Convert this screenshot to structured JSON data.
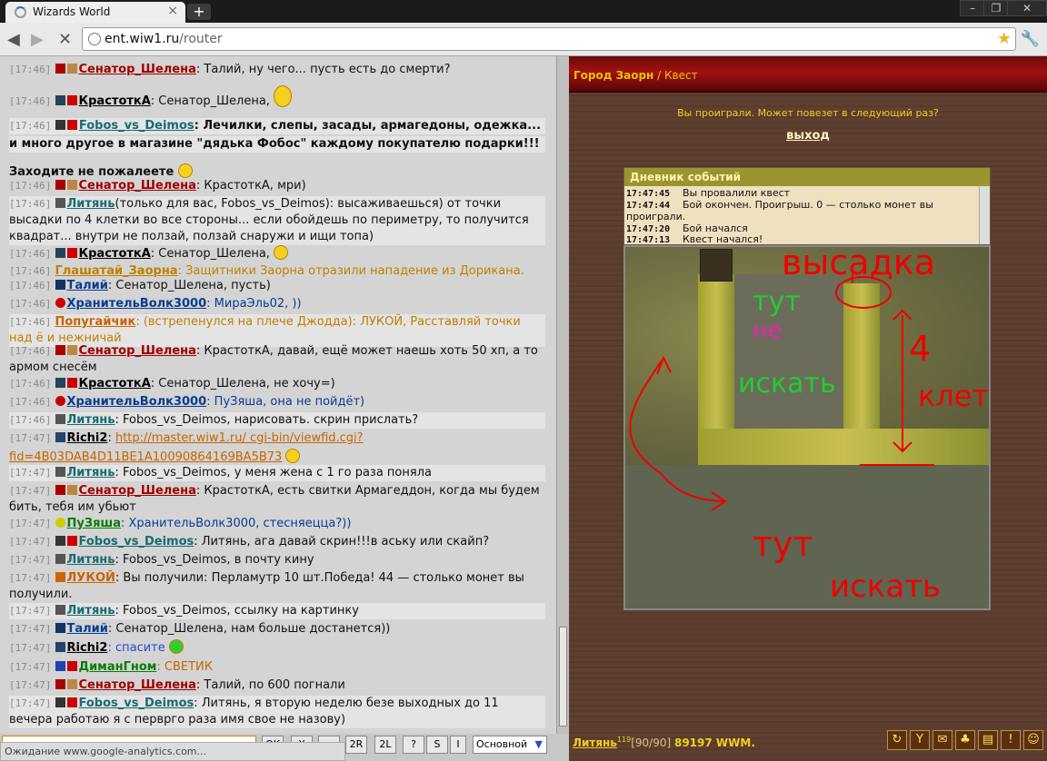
{
  "browser": {
    "tab_title": "Wizards World",
    "tab_close": "×",
    "new_tab": "+",
    "url_host": "ent.wiw1.ru",
    "url_path": "/router",
    "status": "Ожидание www.google-analytics.com..."
  },
  "chat": [
    {
      "time": "[17:46]",
      "nick": "Сенатор_Шелена",
      "nick_color": "#a00000",
      "text": ": Талий, ну чего... пусть есть до смерти?"
    },
    {
      "time": "[17:46]",
      "nick": "КрастоткА",
      "nick_color": "#000000",
      "text": ": Сенатор_Шелена,"
    },
    {
      "time": "[17:46]",
      "nick": "Fobos_vs_Deimos",
      "nick_color": "#1a6b70",
      "text": ": Лечилки, слепы, засады, армагедоны, одежка..."
    },
    {
      "time": "",
      "nick": "",
      "nick_color": "#000000",
      "text": "и много другое в магазине \"дядька Фобос\" каждому покупателю подарки!!!"
    },
    {
      "time": "",
      "nick": "",
      "nick_color": "#000000",
      "text": "Заходите не пожалеете"
    },
    {
      "time": "[17:46]",
      "nick": "Сенатор_Шелена",
      "nick_color": "#a00000",
      "text": ": КрастоткА, мри)"
    },
    {
      "time": "[17:46]",
      "nick": "Литянь",
      "nick_color": "#1a6b70",
      "text": "(только для вас, Fobos_vs_Deimos): высаживаешься) от точки высадки по 4 клетки во все стороны... если обойдешь по периметру, то получится квадрат... внутри не ползай, ползай снаружи и ищи топа)"
    },
    {
      "time": "[17:46]",
      "nick": "КрастоткА",
      "nick_color": "#000000",
      "text": ": Сенатор_Шелена,"
    },
    {
      "time": "[17:46]",
      "nick": "Глашатай_Заорна",
      "nick_color": "#c08000",
      "text": ": Защитники Заорна отразили нападение из Дорикана."
    },
    {
      "time": "[17:46]",
      "nick": "Талий",
      "nick_color": "#0a3c90",
      "text": ": Сенатор_Шелена, пусть)"
    },
    {
      "time": "[17:46]",
      "nick": "ХранительВолк3000",
      "nick_color": "#0a3c90",
      "text": ": МираЭль02, ))"
    },
    {
      "time": "[17:46]",
      "nick": "Попугайчик",
      "nick_color": "#c86400",
      "text": ": (встрепенулся на плече Джодда): ЛУКОЙ, Расставляй точки над ё и нежничай"
    },
    {
      "time": "[17:46]",
      "nick": "Сенатор_Шелена",
      "nick_color": "#a00000",
      "text": ": КрастоткА, давай, ещё может наешь хоть 50 хп, а то армом снесём"
    },
    {
      "time": "[17:46]",
      "nick": "КрастоткА",
      "nick_color": "#000000",
      "text": ": Сенатор_Шелена, не хочу=)"
    },
    {
      "time": "[17:46]",
      "nick": "ХранительВолк3000",
      "nick_color": "#0a3c90",
      "text": ": ПуЗяша, она не пойдёт)"
    },
    {
      "time": "[17:46]",
      "nick": "Литянь",
      "nick_color": "#1a6b70",
      "text": ": Fobos_vs_Deimos, нарисовать. скрин прислать?"
    },
    {
      "time": "[17:47]",
      "nick": "Richi2",
      "nick_color": "#000000",
      "text": ":"
    },
    {
      "time": "",
      "nick": "",
      "nick_color": "#000000",
      "text": ""
    },
    {
      "time": "[17:47]",
      "nick": "Литянь",
      "nick_color": "#1a6b70",
      "text": ": Fobos_vs_Deimos, у меня жена с 1 го раза поняла"
    },
    {
      "time": "[17:47]",
      "nick": "Сенатор_Шелена",
      "nick_color": "#a00000",
      "text": ": КрастоткА, есть свитки Армагеддон, когда мы будем бить, тебя им убьют"
    },
    {
      "time": "[17:47]",
      "nick": "ПуЗяша",
      "nick_color": "#0a7a0a",
      "text": ": ХранительВолк3000, стесняецца?))"
    },
    {
      "time": "[17:47]",
      "nick": "Fobos_vs_Deimos",
      "nick_color": "#1a6b70",
      "text": ": Литянь, ага давай скрин!!!в аську или скайп?"
    },
    {
      "time": "[17:47]",
      "nick": "Литянь",
      "nick_color": "#1a6b70",
      "text": ": Fobos_vs_Deimos, в почту кину"
    },
    {
      "time": "[17:47]",
      "nick": "ЛУКОЙ",
      "nick_color": "#c86400",
      "text": ": Вы получили: Перламутр 10 шт.Победа! 44 — столько монет вы получили."
    },
    {
      "time": "[17:47]",
      "nick": "Литянь",
      "nick_color": "#1a6b70",
      "text": ": Fobos_vs_Deimos, ссылку на картинку"
    },
    {
      "time": "[17:47]",
      "nick": "Талий",
      "nick_color": "#0a3c90",
      "text": ": Сенатор_Шелена, нам больше достанется))"
    },
    {
      "time": "[17:47]",
      "nick": "Richi2",
      "nick_color": "#000000",
      "text": ": спасите"
    },
    {
      "time": "[17:47]",
      "nick": "ДиманГном",
      "nick_color": "#0a7a0a",
      "text": ": СВЕТИК"
    },
    {
      "time": "[17:47]",
      "nick": "Сенатор_Шелена",
      "nick_color": "#a00000",
      "text": ": Талий, по 600 погнали"
    },
    {
      "time": "[17:47]",
      "nick": "Fobos_vs_Deimos",
      "nick_color": "#1a6b70",
      "text": ": Литянь, я вторую неделю безе выходных до 11 вечера работаю я с перврго раза имя свое не назову)"
    }
  ],
  "richi_link": "http://master.wiw1.ru/ cgi-bin/viewfid.cgi?",
  "richi_link2": "fid=4B03DAB4D11BE1A10090864169BA5B73",
  "input_buttons": [
    "OK",
    "X",
    "→",
    "2R",
    "2L",
    "?",
    "S",
    "I"
  ],
  "channel": "Основной",
  "game": {
    "breadcrumb_city": "Город Заорн",
    "breadcrumb_sep": " / ",
    "breadcrumb_page": "Квест",
    "lost_message": "Вы проиграли. Может повезет в следующий раз?",
    "exit_label": "выход",
    "diary_title": "Дневник событий",
    "diary": [
      {
        "time": "17:47:45",
        "text": "Вы провалили квест"
      },
      {
        "time": "17:47:44",
        "text": "Бой окончен. Проигрыш. 0 — столько монет вы проиграли."
      },
      {
        "time": "17:47:20",
        "text": "Бой начался"
      },
      {
        "time": "17:47:13",
        "text": "Квест начался!"
      }
    ],
    "annotations": {
      "vysadka": "высадка",
      "tut_ne": "тут",
      "ne": "не",
      "iskat": "искать",
      "four": "4",
      "kletki": "клетки",
      "tut": "тут",
      "iskat2": "искать"
    },
    "player_name": "Литянь",
    "player_level": "119",
    "player_hp": "[90/90]",
    "player_money": "89197 WWM."
  },
  "colors": {
    "chat_bg": "#d4d4d4",
    "header_red": "#a21212",
    "gold_text": "#f0d020"
  }
}
